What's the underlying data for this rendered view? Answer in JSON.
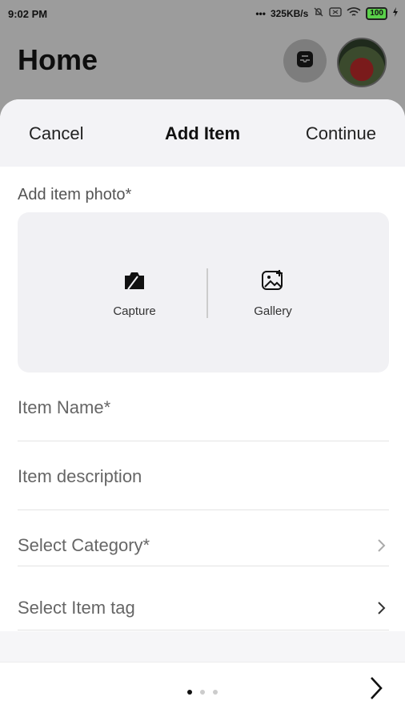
{
  "status_bar": {
    "time": "9:02 PM",
    "speed": "325KB/s",
    "battery": "100"
  },
  "header": {
    "title": "Home"
  },
  "sheet": {
    "cancel_label": "Cancel",
    "title": "Add Item",
    "continue_label": "Continue",
    "photo_label": "Add item photo*",
    "capture_label": "Capture",
    "gallery_label": "Gallery",
    "fields": {
      "item_name": "Item Name*",
      "item_description": "Item description",
      "category": "Select Category*",
      "item_tag": "Select Item tag"
    }
  },
  "pagination": {
    "total": 3,
    "current": 1
  },
  "icons": [
    "inbox-icon",
    "avatar",
    "camera-icon",
    "gallery-icon",
    "chevron-right-icon",
    "next-arrow-icon"
  ]
}
